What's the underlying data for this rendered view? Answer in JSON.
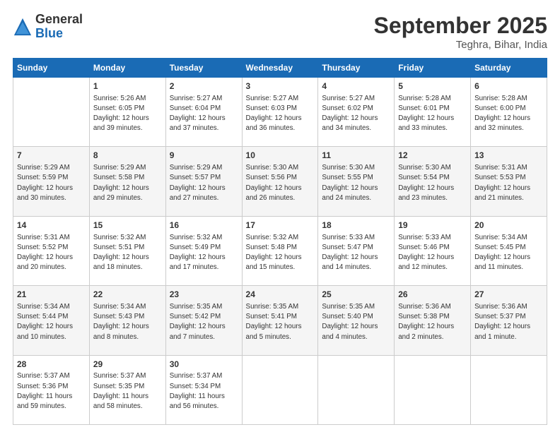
{
  "header": {
    "logo_general": "General",
    "logo_blue": "Blue",
    "month_title": "September 2025",
    "location": "Teghra, Bihar, India"
  },
  "days_of_week": [
    "Sunday",
    "Monday",
    "Tuesday",
    "Wednesday",
    "Thursday",
    "Friday",
    "Saturday"
  ],
  "weeks": [
    [
      {
        "day": "",
        "info": ""
      },
      {
        "day": "1",
        "info": "Sunrise: 5:26 AM\nSunset: 6:05 PM\nDaylight: 12 hours\nand 39 minutes."
      },
      {
        "day": "2",
        "info": "Sunrise: 5:27 AM\nSunset: 6:04 PM\nDaylight: 12 hours\nand 37 minutes."
      },
      {
        "day": "3",
        "info": "Sunrise: 5:27 AM\nSunset: 6:03 PM\nDaylight: 12 hours\nand 36 minutes."
      },
      {
        "day": "4",
        "info": "Sunrise: 5:27 AM\nSunset: 6:02 PM\nDaylight: 12 hours\nand 34 minutes."
      },
      {
        "day": "5",
        "info": "Sunrise: 5:28 AM\nSunset: 6:01 PM\nDaylight: 12 hours\nand 33 minutes."
      },
      {
        "day": "6",
        "info": "Sunrise: 5:28 AM\nSunset: 6:00 PM\nDaylight: 12 hours\nand 32 minutes."
      }
    ],
    [
      {
        "day": "7",
        "info": "Sunrise: 5:29 AM\nSunset: 5:59 PM\nDaylight: 12 hours\nand 30 minutes."
      },
      {
        "day": "8",
        "info": "Sunrise: 5:29 AM\nSunset: 5:58 PM\nDaylight: 12 hours\nand 29 minutes."
      },
      {
        "day": "9",
        "info": "Sunrise: 5:29 AM\nSunset: 5:57 PM\nDaylight: 12 hours\nand 27 minutes."
      },
      {
        "day": "10",
        "info": "Sunrise: 5:30 AM\nSunset: 5:56 PM\nDaylight: 12 hours\nand 26 minutes."
      },
      {
        "day": "11",
        "info": "Sunrise: 5:30 AM\nSunset: 5:55 PM\nDaylight: 12 hours\nand 24 minutes."
      },
      {
        "day": "12",
        "info": "Sunrise: 5:30 AM\nSunset: 5:54 PM\nDaylight: 12 hours\nand 23 minutes."
      },
      {
        "day": "13",
        "info": "Sunrise: 5:31 AM\nSunset: 5:53 PM\nDaylight: 12 hours\nand 21 minutes."
      }
    ],
    [
      {
        "day": "14",
        "info": "Sunrise: 5:31 AM\nSunset: 5:52 PM\nDaylight: 12 hours\nand 20 minutes."
      },
      {
        "day": "15",
        "info": "Sunrise: 5:32 AM\nSunset: 5:51 PM\nDaylight: 12 hours\nand 18 minutes."
      },
      {
        "day": "16",
        "info": "Sunrise: 5:32 AM\nSunset: 5:49 PM\nDaylight: 12 hours\nand 17 minutes."
      },
      {
        "day": "17",
        "info": "Sunrise: 5:32 AM\nSunset: 5:48 PM\nDaylight: 12 hours\nand 15 minutes."
      },
      {
        "day": "18",
        "info": "Sunrise: 5:33 AM\nSunset: 5:47 PM\nDaylight: 12 hours\nand 14 minutes."
      },
      {
        "day": "19",
        "info": "Sunrise: 5:33 AM\nSunset: 5:46 PM\nDaylight: 12 hours\nand 12 minutes."
      },
      {
        "day": "20",
        "info": "Sunrise: 5:34 AM\nSunset: 5:45 PM\nDaylight: 12 hours\nand 11 minutes."
      }
    ],
    [
      {
        "day": "21",
        "info": "Sunrise: 5:34 AM\nSunset: 5:44 PM\nDaylight: 12 hours\nand 10 minutes."
      },
      {
        "day": "22",
        "info": "Sunrise: 5:34 AM\nSunset: 5:43 PM\nDaylight: 12 hours\nand 8 minutes."
      },
      {
        "day": "23",
        "info": "Sunrise: 5:35 AM\nSunset: 5:42 PM\nDaylight: 12 hours\nand 7 minutes."
      },
      {
        "day": "24",
        "info": "Sunrise: 5:35 AM\nSunset: 5:41 PM\nDaylight: 12 hours\nand 5 minutes."
      },
      {
        "day": "25",
        "info": "Sunrise: 5:35 AM\nSunset: 5:40 PM\nDaylight: 12 hours\nand 4 minutes."
      },
      {
        "day": "26",
        "info": "Sunrise: 5:36 AM\nSunset: 5:38 PM\nDaylight: 12 hours\nand 2 minutes."
      },
      {
        "day": "27",
        "info": "Sunrise: 5:36 AM\nSunset: 5:37 PM\nDaylight: 12 hours\nand 1 minute."
      }
    ],
    [
      {
        "day": "28",
        "info": "Sunrise: 5:37 AM\nSunset: 5:36 PM\nDaylight: 11 hours\nand 59 minutes."
      },
      {
        "day": "29",
        "info": "Sunrise: 5:37 AM\nSunset: 5:35 PM\nDaylight: 11 hours\nand 58 minutes."
      },
      {
        "day": "30",
        "info": "Sunrise: 5:37 AM\nSunset: 5:34 PM\nDaylight: 11 hours\nand 56 minutes."
      },
      {
        "day": "",
        "info": ""
      },
      {
        "day": "",
        "info": ""
      },
      {
        "day": "",
        "info": ""
      },
      {
        "day": "",
        "info": ""
      }
    ]
  ]
}
